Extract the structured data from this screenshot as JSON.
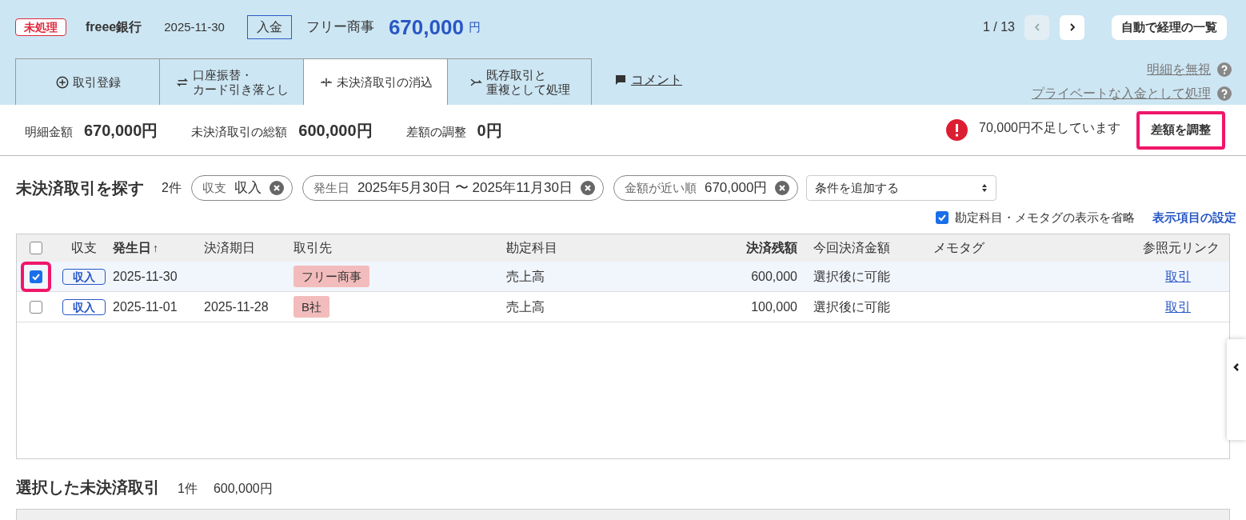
{
  "header": {
    "status_badge": "未処理",
    "bank": "freee銀行",
    "date": "2025-11-30",
    "direction": "入金",
    "partner": "フリー商事",
    "amount": "670,000",
    "currency": "円",
    "pager": "1 / 13",
    "prev_disabled": true,
    "list_button": "自動で経理の一覧"
  },
  "tabs": [
    {
      "lines": [
        "取引登録"
      ],
      "selected": false
    },
    {
      "lines": [
        "口座振替・",
        "カード引き落とし"
      ],
      "selected": false
    },
    {
      "lines": [
        "未決済取引の消込"
      ],
      "selected": true
    },
    {
      "lines": [
        "既存取引と",
        "重複として処理"
      ],
      "selected": false
    }
  ],
  "comment_link": "コメント",
  "side_links": [
    "明細を無視",
    "プライベートな入金として処理"
  ],
  "summary": {
    "items": [
      {
        "label": "明細金額",
        "value": "670,000円"
      },
      {
        "label": "未決済取引の総額",
        "value": "600,000円"
      },
      {
        "label": "差額の調整",
        "value": "0円"
      }
    ],
    "warning": "70,000円不足しています",
    "adjust_button": "差額を調整",
    "adjust_highlighted": true
  },
  "search": {
    "title": "未決済取引を探す",
    "count": "2件",
    "filters": [
      {
        "label": "収支",
        "value": "収入"
      },
      {
        "label": "発生日",
        "value": "2025年5月30日 〜 2025年11月30日"
      },
      {
        "label": "金額が近い順",
        "value": "670,000円"
      }
    ],
    "add_condition": "条件を追加する",
    "omit_checkbox": {
      "label": "勘定科目・メモタグの表示を省略",
      "checked": true
    },
    "settings_link": "表示項目の設定"
  },
  "table": {
    "all_checked": false,
    "columns": [
      "収支",
      "発生日",
      "決済期日",
      "取引先",
      "勘定科目",
      "決済残額",
      "今回決済金額",
      "メモタグ",
      "参照元リンク"
    ],
    "sort_arrow": "↑",
    "rows": [
      {
        "selected": true,
        "highlighted": true,
        "type": "収入",
        "date": "2025-11-30",
        "due": "",
        "partner": "フリー商事",
        "account": "売上高",
        "balance": "600,000",
        "pay": "選択後に可能",
        "link": "取引"
      },
      {
        "selected": false,
        "highlighted": false,
        "type": "収入",
        "date": "2025-11-01",
        "due": "2025-11-28",
        "partner": "B社",
        "account": "売上高",
        "balance": "100,000",
        "pay": "選択後に可能",
        "link": "取引"
      }
    ]
  },
  "selected_section": {
    "title": "選択した未決済取引",
    "count": "1件",
    "total": "600,000円"
  }
}
